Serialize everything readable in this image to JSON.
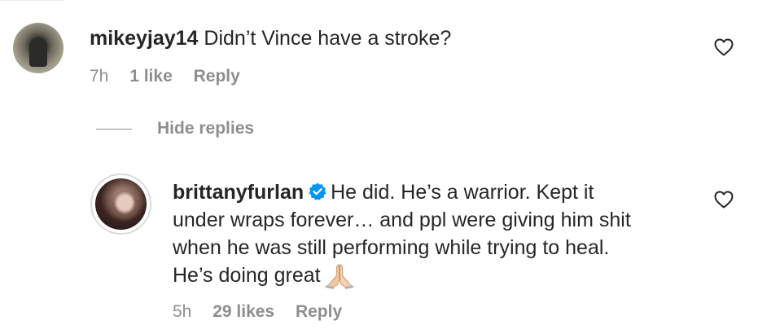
{
  "comment1": {
    "username": "mikeyjay14",
    "text": "Didn’t Vince have a stroke?",
    "time": "7h",
    "likes": "1 like",
    "reply": "Reply"
  },
  "hide_replies": "Hide replies",
  "comment2": {
    "username": "brittanyfurlan",
    "verified": true,
    "line1": "He did. He’s a warrior. Kept it",
    "line2": "under wraps forever… and ppl were giving him shit",
    "line3": "when he was still performing while trying to heal.",
    "line4": "He’s doing great",
    "emoji": "folded-hands",
    "time": "5h",
    "likes": "29 likes",
    "reply": "Reply"
  },
  "colors": {
    "text": "#262626",
    "secondary": "#8e8e8e",
    "verified_blue": "#0095f6"
  },
  "icons": [
    "heart-icon",
    "verified-badge-icon",
    "folded-hands-emoji"
  ]
}
